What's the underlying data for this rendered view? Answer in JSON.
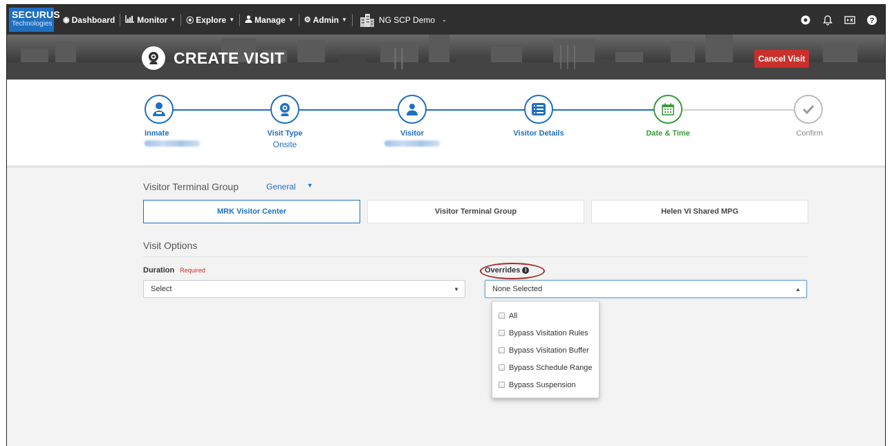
{
  "brand": {
    "name": "SECURUS",
    "sub": "Technologies"
  },
  "nav": {
    "items": [
      {
        "label": "Dashboard",
        "icon": "tachometer-icon",
        "caret": false
      },
      {
        "label": "Monitor",
        "icon": "chart-icon",
        "caret": true
      },
      {
        "label": "Explore",
        "icon": "compass-icon",
        "caret": true
      },
      {
        "label": "Manage",
        "icon": "user-icon",
        "caret": true
      },
      {
        "label": "Admin",
        "icon": "gear-icon",
        "caret": true
      }
    ],
    "site": "NG SCP Demo"
  },
  "banner": {
    "title": "CREATE VISIT",
    "cancel_label": "Cancel Visit"
  },
  "steps": [
    {
      "label": "Inmate",
      "value": "",
      "state": "done"
    },
    {
      "label": "Visit Type",
      "value": "Onsite",
      "state": "done"
    },
    {
      "label": "Visitor",
      "value": "",
      "state": "done"
    },
    {
      "label": "Visitor Details",
      "value": "",
      "state": "done"
    },
    {
      "label": "Date & Time",
      "value": "",
      "state": "current"
    },
    {
      "label": "Confirm",
      "value": "",
      "state": "pending"
    }
  ],
  "terminal": {
    "label": "Visitor Terminal Group",
    "group_value": "General",
    "options": [
      "MRK Visitor Center",
      "Visitor Terminal Group",
      "Helen VI Shared MPG"
    ]
  },
  "visit_options": {
    "title": "Visit Options",
    "duration": {
      "label": "Duration",
      "required_label": "Required",
      "value": "Select"
    },
    "overrides": {
      "label": "Overrides",
      "value": "None Selected",
      "options": [
        "All",
        "Bypass Visitation Rules",
        "Bypass Visitation Buffer",
        "Bypass Schedule Range",
        "Bypass Suspension"
      ]
    }
  },
  "colors": {
    "primary": "#1f6fc0",
    "success": "#3a9a3a",
    "danger": "#c9302c"
  }
}
